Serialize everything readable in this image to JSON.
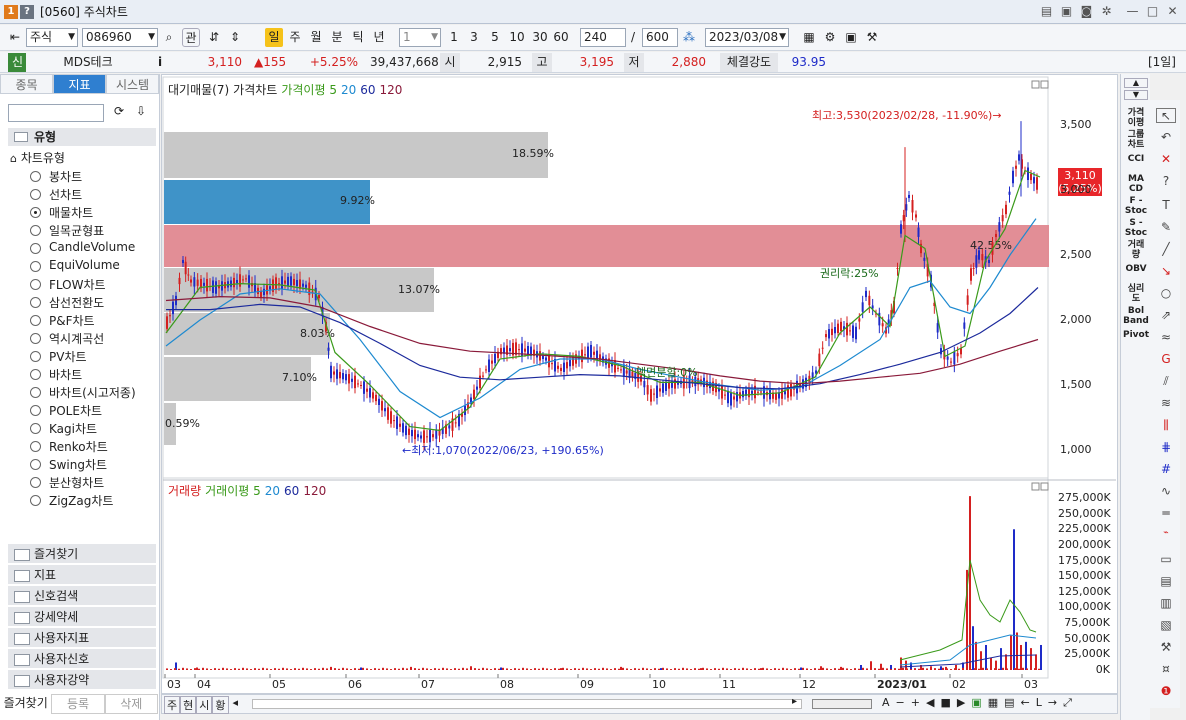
{
  "window": {
    "badge1": "1",
    "badge2": "?",
    "title": "[0560] 주식차트"
  },
  "toolbar": {
    "market": "주식",
    "code": "086960",
    "btn_gwan": "관",
    "periods": [
      "일",
      "주",
      "월",
      "분",
      "틱",
      "년"
    ],
    "active_period": "일",
    "dropdown_val": "1",
    "quick_counts": [
      "1",
      "3",
      "5",
      "10",
      "30",
      "60"
    ],
    "count_val": "240",
    "slash": "/",
    "total_val": "600",
    "date_val": "2023/03/08"
  },
  "infobar": {
    "sin": "신",
    "name": "MDS테크",
    "i_btn": "i",
    "price": "3,110",
    "change": "▲155",
    "change_pct": "+5.25%",
    "volume": "39,437,668",
    "open_label": "시",
    "open_val": "2,915",
    "high_label": "고",
    "high_val": "3,195",
    "low_label": "저",
    "low_val": "2,880",
    "strength_label": "체결강도",
    "strength_val": "93.95",
    "period_tag": "[1일]"
  },
  "leftpanel": {
    "tabs": [
      "종목",
      "지표",
      "시스템"
    ],
    "active_tab": "지표",
    "section": "유형",
    "group": "차트유형",
    "chart_types": [
      "봉차트",
      "선차트",
      "매물차트",
      "일목균형표",
      "CandleVolume",
      "EquiVolume",
      "FLOW차트",
      "삼선전환도",
      "P&F차트",
      "역시계곡선",
      "PV차트",
      "바차트",
      "바차트(시고저종)",
      "POLE차트",
      "Kagi차트",
      "Renko차트",
      "Swing차트",
      "분산형차트",
      "ZigZag차트"
    ],
    "selected_type": "매물차트",
    "folders": [
      "즐겨찾기",
      "지표",
      "신호검색",
      "강세약세",
      "사용자지표",
      "사용자신호",
      "사용자강약"
    ],
    "bottom_tabs": [
      "즐겨찾기",
      "등록",
      "삭제"
    ]
  },
  "price_chart": {
    "legend": [
      "대기매물(7)",
      "가격차트",
      "가격이평 5",
      "20",
      "60",
      "120"
    ],
    "y_ticks": [
      "3,500",
      "3,000",
      "2,500",
      "2,000",
      "1,500",
      "1,000"
    ],
    "last_price": "3,110",
    "last_pct": "(5.25%)",
    "high_label": "최고:3,530(2023/02/28, -11.90%)→",
    "low_label": "←최저:1,070(2022/06/23, +190.65%)",
    "rights_label": "권리락:25%",
    "split_label": "액면분할:0%",
    "volume_profile": [
      {
        "label": "18.59%",
        "value": 18.59
      },
      {
        "label": "9.92%",
        "value": 9.92
      },
      {
        "label": "42.55%",
        "value": 42.55
      },
      {
        "label": "13.07%",
        "value": 13.07
      },
      {
        "label": "8.03%",
        "value": 8.03
      },
      {
        "label": "7.10%",
        "value": 7.1
      },
      {
        "label": "0.59%",
        "value": 0.59
      }
    ]
  },
  "volume_chart": {
    "legend": [
      "거래량",
      "거래이평 5",
      "20",
      "60",
      "120"
    ],
    "y_ticks": [
      "275,000K",
      "250,000K",
      "225,000K",
      "200,000K",
      "175,000K",
      "150,000K",
      "125,000K",
      "100,000K",
      "75,000K",
      "50,000K",
      "25,000K",
      "0K"
    ]
  },
  "x_ticks": [
    "03",
    "04",
    "05",
    "06",
    "07",
    "08",
    "09",
    "10",
    "11",
    "12",
    "2023/01",
    "02",
    "03"
  ],
  "bottom_tabs": [
    "주",
    "현",
    "시",
    "황"
  ],
  "right_tools": [
    "가격\n이평",
    "그룹\n차트",
    "CCI",
    "MA\nCD",
    "F -\nStoc",
    "S -\nStoc",
    "거래\n량",
    "OBV",
    "심리\n도",
    "Bol\nBand",
    "Pivot"
  ],
  "colors": {
    "up": "#d42020",
    "down": "#1e2bc8",
    "ma5": "#3a9a1a",
    "ma20": "#1e8ad0",
    "ma60": "#1c2a9c",
    "ma120": "#8a1a3a",
    "profile_gray": "#c8c8c8",
    "profile_blue": "#3f93c8",
    "profile_red": "#e08890",
    "active_tab": "#2f7fd0",
    "active_period": "#f5c21a"
  }
}
